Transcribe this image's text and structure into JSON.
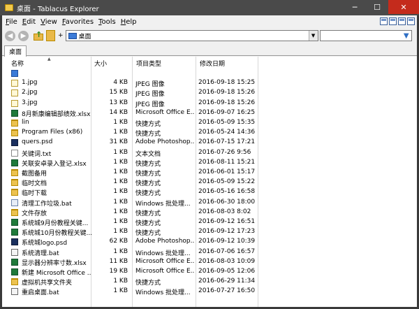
{
  "window": {
    "title": "桌面 - Tablacus Explorer"
  },
  "menu": [
    "File",
    "Edit",
    "View",
    "Favorites",
    "Tools",
    "Help"
  ],
  "address": {
    "value": "桌面"
  },
  "search": {
    "placeholder": ""
  },
  "tabs": [
    {
      "label": "桌面"
    }
  ],
  "columns": {
    "name": "名称",
    "size": "大小",
    "type": "项目类型",
    "date": "修改日期"
  },
  "rows": [
    {
      "icon": "desktop-icon",
      "name": "",
      "size": "",
      "type": "",
      "date": ""
    },
    {
      "icon": "jpg-icon",
      "name": "1.jpg",
      "size": "4 KB",
      "type": "JPEG 图像",
      "date": "2016-09-18 15:25"
    },
    {
      "icon": "jpg-icon",
      "name": "2.jpg",
      "size": "15 KB",
      "type": "JPEG 图像",
      "date": "2016-09-18 15:26"
    },
    {
      "icon": "jpg-icon",
      "name": "3.jpg",
      "size": "13 KB",
      "type": "JPEG 图像",
      "date": "2016-09-18 15:26"
    },
    {
      "icon": "xlsx-icon",
      "name": "8月新康编辑部绩效.xlsx",
      "size": "14 KB",
      "type": "Microsoft Office E...",
      "date": "2016-09-07 16:25"
    },
    {
      "icon": "folder-icon",
      "name": "lin",
      "size": "1 KB",
      "type": "快捷方式",
      "date": "2016-05-09 15:35"
    },
    {
      "icon": "folder-icon",
      "name": "Program Files (x86)",
      "size": "1 KB",
      "type": "快捷方式",
      "date": "2016-05-24 14:36"
    },
    {
      "icon": "psd-icon",
      "name": "quers.psd",
      "size": "31 KB",
      "type": "Adobe Photoshop...",
      "date": "2016-07-15 17:21"
    },
    {
      "icon": "txt-icon",
      "name": "关键词.txt",
      "size": "1 KB",
      "type": "文本文档",
      "date": "2016-07-26 9:56"
    },
    {
      "icon": "xlsx-icon",
      "name": "关联安卓录入登记.xlsx",
      "size": "1 KB",
      "type": "快捷方式",
      "date": "2016-08-11 15:21"
    },
    {
      "icon": "folder-icon",
      "name": "截图备用",
      "size": "1 KB",
      "type": "快捷方式",
      "date": "2016-06-01 15:17"
    },
    {
      "icon": "folder-icon",
      "name": "临时文档",
      "size": "1 KB",
      "type": "快捷方式",
      "date": "2016-05-09 15:22"
    },
    {
      "icon": "folder-icon",
      "name": "临时下载",
      "size": "1 KB",
      "type": "快捷方式",
      "date": "2016-05-16 16:58"
    },
    {
      "icon": "lnk-icon",
      "name": "清理工作垃圾.bat",
      "size": "1 KB",
      "type": "Windows 批处理...",
      "date": "2016-06-30 18:00"
    },
    {
      "icon": "folder-icon",
      "name": "文件存放",
      "size": "1 KB",
      "type": "快捷方式",
      "date": "2016-08-03 8:02"
    },
    {
      "icon": "xlsx-icon",
      "name": "系统城9月份教程关键...",
      "size": "1 KB",
      "type": "快捷方式",
      "date": "2016-09-12 16:51"
    },
    {
      "icon": "xlsx-icon",
      "name": "系统城10月份教程关键...",
      "size": "1 KB",
      "type": "快捷方式",
      "date": "2016-09-12 17:23"
    },
    {
      "icon": "psd-icon",
      "name": "系统城logo.psd",
      "size": "62 KB",
      "type": "Adobe Photoshop...",
      "date": "2016-09-12 10:39"
    },
    {
      "icon": "bat-icon",
      "name": "系统清理.bat",
      "size": "1 KB",
      "type": "Windows 批处理...",
      "date": "2016-07-06 16:57"
    },
    {
      "icon": "xlsx-icon",
      "name": "显示器分辨率寸数.xlsx",
      "size": "11 KB",
      "type": "Microsoft Office E...",
      "date": "2016-08-03 10:09"
    },
    {
      "icon": "xlsx-icon",
      "name": "新建 Microsoft Office ...",
      "size": "19 KB",
      "type": "Microsoft Office E...",
      "date": "2016-09-05 12:06"
    },
    {
      "icon": "folder-icon",
      "name": "虚拟机共享文件夹",
      "size": "1 KB",
      "type": "快捷方式",
      "date": "2016-06-29 11:34"
    },
    {
      "icon": "bat-icon",
      "name": "重启桌面.bat",
      "size": "1 KB",
      "type": "Windows 批处理...",
      "date": "2016-07-27 16:50"
    }
  ]
}
